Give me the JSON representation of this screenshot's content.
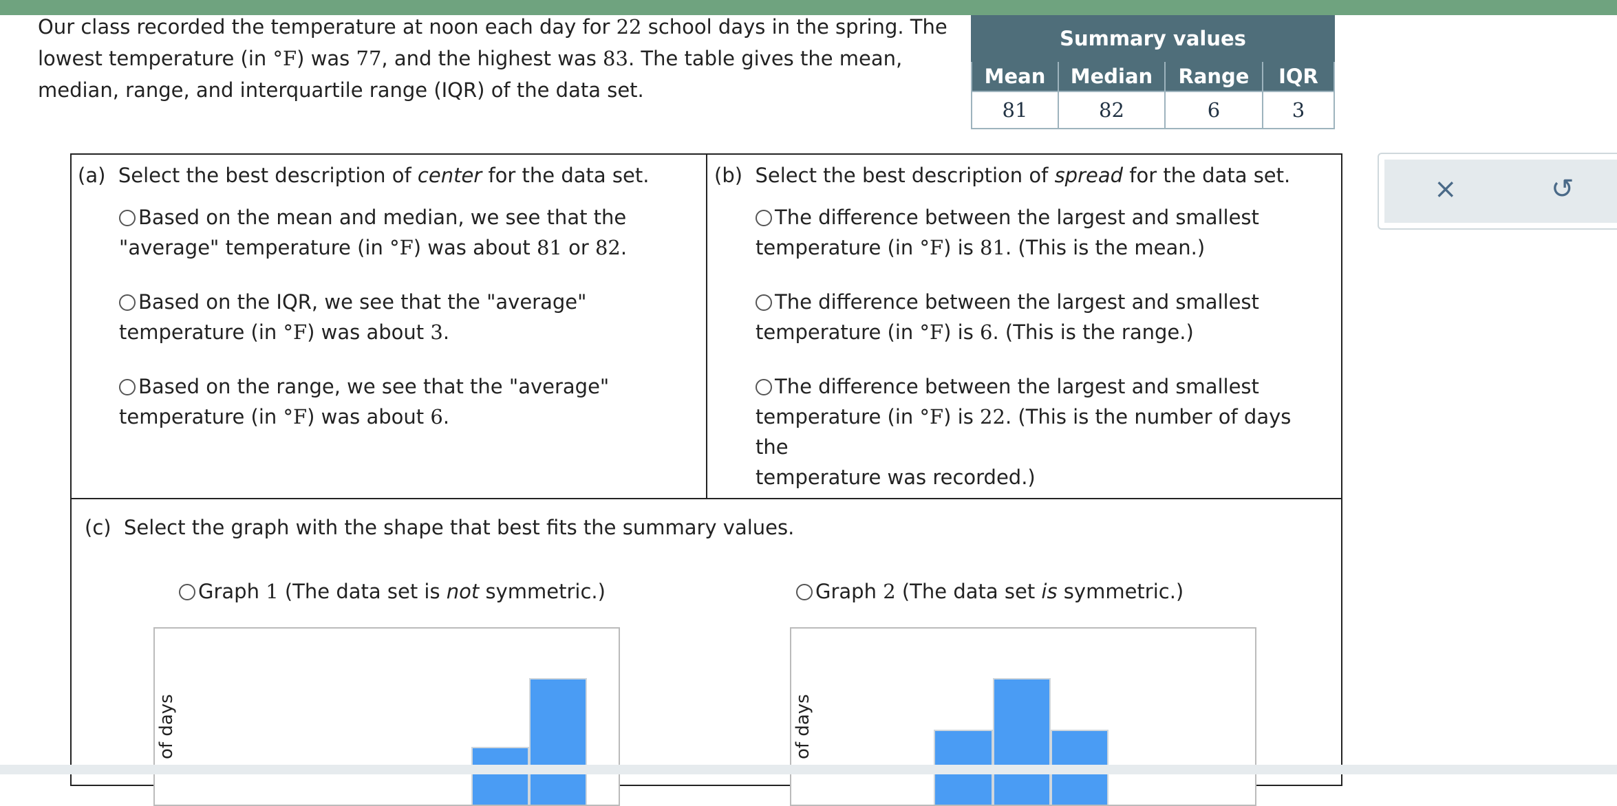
{
  "intro": {
    "p1": "Our class recorded the temperature at noon each day for ",
    "n_days": "22",
    "p2": " school days in the spring. The lowest temperature (in ",
    "unit": "°F",
    "p3": ") was ",
    "lowest": "77",
    "p4": ", and the highest was ",
    "highest": "83",
    "p5": ". The table gives the mean, median, range, and interquartile range (IQR) of the data set."
  },
  "summary": {
    "title": "Summary values",
    "headers": [
      "Mean",
      "Median",
      "Range",
      "IQR"
    ],
    "values": [
      "81",
      "82",
      "6",
      "3"
    ]
  },
  "part_a": {
    "label": "(a)",
    "prompt_pre": "Select the best description of ",
    "prompt_em": "center",
    "prompt_post": " for the data set.",
    "options": [
      {
        "l1": "Based on the mean and median, we see that the",
        "l2a": "\"average\" temperature (in ",
        "unit": "°F",
        "l2b": ") was about ",
        "n1": "81",
        "mid": " or ",
        "n2": "82",
        "end": "."
      },
      {
        "l1": "Based on the IQR, we see that the \"average\"",
        "l2a": "temperature (in ",
        "unit": "°F",
        "l2b": ") was about ",
        "n1": "3",
        "end": "."
      },
      {
        "l1": "Based on the range, we see that the \"average\"",
        "l2a": "temperature (in ",
        "unit": "°F",
        "l2b": ") was about ",
        "n1": "6",
        "end": "."
      }
    ]
  },
  "part_b": {
    "label": "(b)",
    "prompt_pre": "Select the best description of ",
    "prompt_em": "spread",
    "prompt_post": " for the data set.",
    "options": [
      {
        "l1": "The difference between the largest and smallest",
        "l2a": "temperature (in ",
        "unit": "°F",
        "l2b": ") is ",
        "n1": "81",
        "end": ". (This is the mean.)"
      },
      {
        "l1": "The difference between the largest and smallest",
        "l2a": "temperature (in ",
        "unit": "°F",
        "l2b": ") is ",
        "n1": "6",
        "end": ". (This is the range.)"
      },
      {
        "l1": "The difference between the largest and smallest",
        "l2a": "temperature (in ",
        "unit": "°F",
        "l2b": ") is ",
        "n1": "22",
        "end": ". (This is the number of days the",
        "l3": "temperature was recorded.)"
      }
    ]
  },
  "part_c": {
    "label": "(c)",
    "prompt": "Select the graph with the shape that best fits the summary values.",
    "graph1": {
      "pre": "Graph ",
      "num": "1",
      "mid": " (The data set is ",
      "em": "not",
      "post": " symmetric.)"
    },
    "graph2": {
      "pre": "Graph ",
      "num": "2",
      "mid": " (The data set ",
      "em": "is",
      "post": " symmetric.)"
    },
    "ylabel": "of days"
  },
  "controls": {
    "clear_icon": "close-icon",
    "clear_glyph": "×",
    "reset_icon": "undo-icon",
    "reset_glyph": "↺"
  },
  "colors": {
    "accent": "#6fa37f",
    "table_header": "#4f6e7a",
    "bar": "#4a9cf4"
  }
}
